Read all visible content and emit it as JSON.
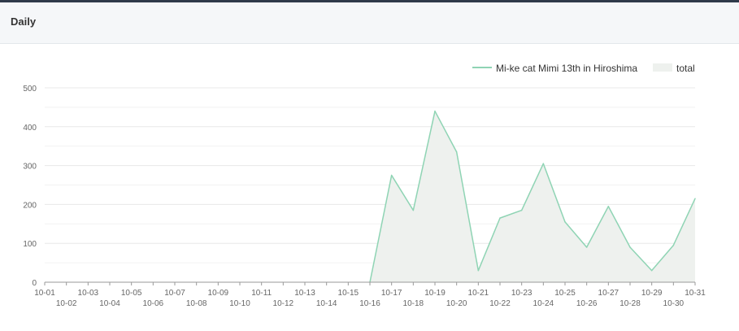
{
  "card": {
    "title": "Daily"
  },
  "chart_data": {
    "type": "line",
    "x": [
      "10-01",
      "10-02",
      "10-03",
      "10-04",
      "10-05",
      "10-06",
      "10-07",
      "10-08",
      "10-09",
      "10-10",
      "10-11",
      "10-12",
      "10-13",
      "10-14",
      "10-15",
      "10-16",
      "10-17",
      "10-18",
      "10-19",
      "10-20",
      "10-21",
      "10-22",
      "10-23",
      "10-24",
      "10-25",
      "10-26",
      "10-27",
      "10-28",
      "10-29",
      "10-30",
      "10-31"
    ],
    "series": [
      {
        "name": "Mi-ke cat Mimi 13th in Hiroshima",
        "color": "#8fd4b4",
        "values": [
          0,
          0,
          0,
          0,
          0,
          0,
          0,
          0,
          0,
          0,
          0,
          0,
          0,
          0,
          0,
          0,
          275,
          185,
          440,
          335,
          30,
          165,
          185,
          305,
          155,
          90,
          195,
          90,
          30,
          95,
          215
        ]
      },
      {
        "name": "total",
        "type": "area",
        "fill": "#eef1ee",
        "values": [
          0,
          0,
          0,
          0,
          0,
          0,
          0,
          0,
          0,
          0,
          0,
          0,
          0,
          0,
          0,
          0,
          275,
          185,
          440,
          335,
          30,
          165,
          185,
          305,
          155,
          90,
          195,
          90,
          30,
          95,
          215
        ]
      }
    ],
    "y_ticks": [
      0,
      100,
      200,
      300,
      400,
      500
    ],
    "ylim": [
      0,
      500
    ],
    "grid": true,
    "legend_position": "top-right"
  }
}
